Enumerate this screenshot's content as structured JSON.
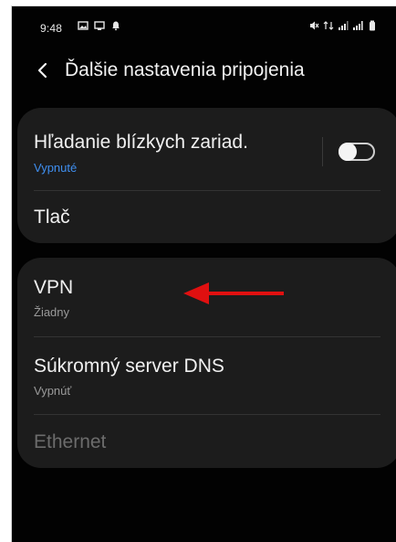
{
  "status_bar": {
    "time": "9:48",
    "left_icons": [
      "image-icon",
      "cast-icon",
      "notification-icon"
    ],
    "right_icons": [
      "mute-icon",
      "data-4g-icon",
      "signal-icon",
      "signal-icon",
      "battery-icon"
    ]
  },
  "header": {
    "back_icon": "chevron-left-icon",
    "title": "Ďalšie nastavenia pripojenia"
  },
  "section_1": {
    "nearby_scan": {
      "title": "Hľadanie blízkych zariad.",
      "status": "Vypnuté",
      "toggle_on": false
    },
    "print": {
      "title": "Tlač"
    }
  },
  "section_2": {
    "vpn": {
      "title": "VPN",
      "status": "Žiadny"
    },
    "private_dns": {
      "title": "Súkromný server DNS",
      "status": "Vypnúť"
    },
    "ethernet": {
      "title": "Ethernet",
      "enabled": false
    }
  },
  "annotation": {
    "arrow_color": "#e01010"
  },
  "colors": {
    "background": "#020202",
    "card": "#1c1c1c",
    "accent": "#3f8ff0",
    "annotation": "#e01010"
  }
}
